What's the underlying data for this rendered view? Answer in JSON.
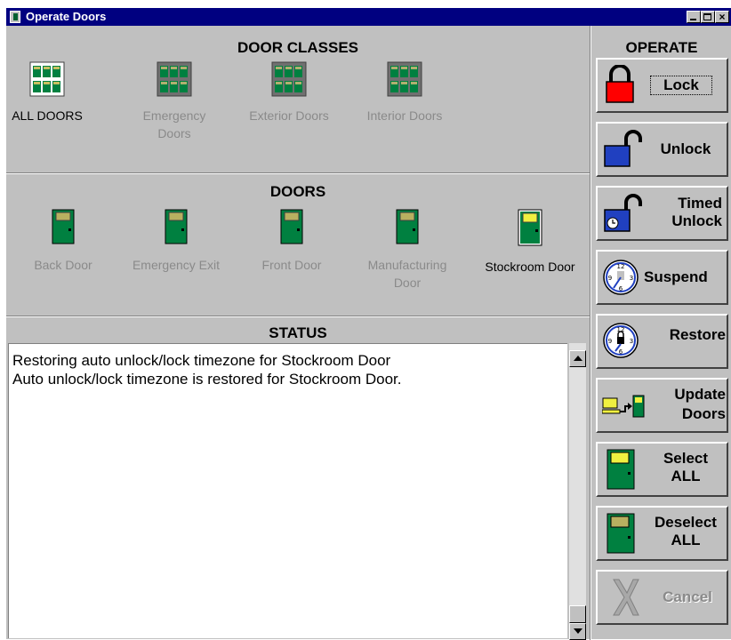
{
  "window": {
    "title": "Operate Doors"
  },
  "door_classes": {
    "title": "DOOR CLASSES",
    "items": [
      {
        "label": "ALL DOORS",
        "active": true
      },
      {
        "label": "Emergency Doors",
        "active": false
      },
      {
        "label": "Exterior Doors",
        "active": false
      },
      {
        "label": "Interior Doors",
        "active": false
      }
    ]
  },
  "doors": {
    "title": "DOORS",
    "items": [
      {
        "label": "Back Door",
        "active": false
      },
      {
        "label": "Emergency Exit",
        "active": false
      },
      {
        "label": "Front Door",
        "active": false
      },
      {
        "label": "Manufacturing Door",
        "active": false
      },
      {
        "label": "Stockroom Door",
        "active": true
      }
    ]
  },
  "status": {
    "title": "STATUS",
    "lines": [
      "Restoring auto unlock/lock timezone for Stockroom Door",
      "Auto unlock/lock timezone is restored for Stockroom Door."
    ]
  },
  "operate": {
    "title": "OPERATE",
    "buttons": {
      "lock": "Lock",
      "unlock": "Unlock",
      "timed_unlock_1": "Timed",
      "timed_unlock_2": "Unlock",
      "suspend": "Suspend",
      "restore": "Restore",
      "update_1": "Update",
      "update_2": "Doors",
      "select_1": "Select",
      "select_2": "ALL",
      "deselect_1": "Deselect",
      "deselect_2": "ALL",
      "cancel": "Cancel"
    }
  },
  "colors": {
    "titlebar": "#000080",
    "door_green": "#008040",
    "lock_red": "#ff0000",
    "unlock_blue": "#2040c0"
  }
}
